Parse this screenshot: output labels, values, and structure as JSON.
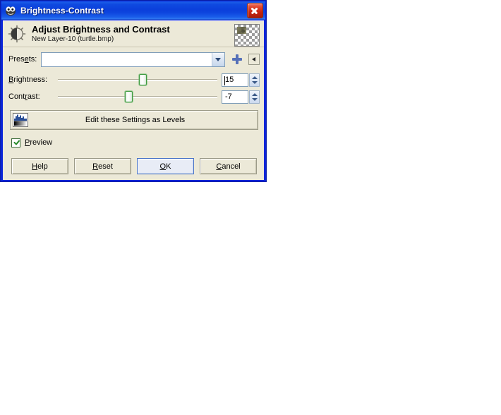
{
  "window": {
    "title": "Brightness-Contrast",
    "title_icon": "gimp-wilber-icon",
    "close_icon": "close-icon"
  },
  "header": {
    "icon": "brightness-contrast-icon",
    "title": "Adjust Brightness and Contrast",
    "subtitle": "New Layer-10 (turtle.bmp)",
    "thumbnail_icon": "layer-thumbnail-transparent"
  },
  "presets": {
    "label_pre": "Pres",
    "label_mnemonic": "e",
    "label_post": "ts:",
    "value": "",
    "placeholder": "",
    "dropdown_icon": "chevron-down-icon",
    "add_icon": "plus-icon",
    "menu_icon": "triangle-left-icon"
  },
  "brightness": {
    "label_mnemonic": "B",
    "label_rest": "rightness:",
    "value": "15",
    "slider_percent": 53.5,
    "min": -127,
    "max": 127,
    "spinner_icon": "spinner-arrows-icon"
  },
  "contrast": {
    "label_pre": "Cont",
    "label_mnemonic": "r",
    "label_post": "ast:",
    "value": "-7",
    "slider_percent": 44.6,
    "min": -127,
    "max": 127,
    "spinner_icon": "spinner-arrows-icon"
  },
  "levels_button": {
    "label": "Edit these Settings as Levels",
    "icon": "levels-histogram-icon"
  },
  "preview": {
    "label_mnemonic": "P",
    "label_rest": "review",
    "checked": true,
    "check_icon": "checkmark-icon"
  },
  "buttons": [
    {
      "id": "help",
      "pre": "",
      "mnemonic": "H",
      "post": "elp",
      "default": false
    },
    {
      "id": "reset",
      "pre": "",
      "mnemonic": "R",
      "post": "eset",
      "default": false
    },
    {
      "id": "ok",
      "pre": "",
      "mnemonic": "O",
      "post": "K",
      "default": true
    },
    {
      "id": "cancel",
      "pre": "",
      "mnemonic": "C",
      "post": "ancel",
      "default": false
    }
  ],
  "colors": {
    "titlebar_blue": "#0b3fdb",
    "dialog_face": "#ece9d8",
    "slider_green": "#3f9b3f",
    "accent_blue": "#5570b8",
    "close_red": "#c62410"
  }
}
